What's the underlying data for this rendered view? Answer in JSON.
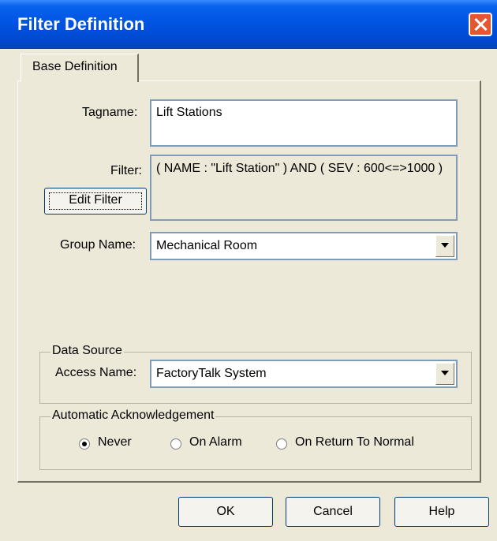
{
  "window": {
    "title": "Filter Definition",
    "close_icon": "close-icon"
  },
  "tabs": [
    {
      "label": "Base Definition",
      "selected": true
    }
  ],
  "form": {
    "tagname_label": "Tagname:",
    "tagname_value": "Lift Stations",
    "filter_label": "Filter:",
    "filter_value": "( NAME : \"Lift Station\" ) AND ( SEV : 600<=>1000 )",
    "edit_filter_label": "Edit Filter",
    "group_name_label": "Group Name:",
    "group_name_value": "Mechanical Room"
  },
  "data_source": {
    "legend": "Data Source",
    "access_name_label": "Access Name:",
    "access_name_value": "FactoryTalk System"
  },
  "auto_ack": {
    "legend": "Automatic Acknowledgement",
    "options": [
      {
        "label": "Never",
        "selected": true
      },
      {
        "label": "On Alarm",
        "selected": false
      },
      {
        "label": "On Return To Normal",
        "selected": false
      }
    ]
  },
  "buttons": {
    "ok": "OK",
    "cancel": "Cancel",
    "help": "Help"
  },
  "colors": {
    "title_bar": "#0054e3",
    "close_button": "#e3562f",
    "dialog_bg": "#ece9d8"
  }
}
